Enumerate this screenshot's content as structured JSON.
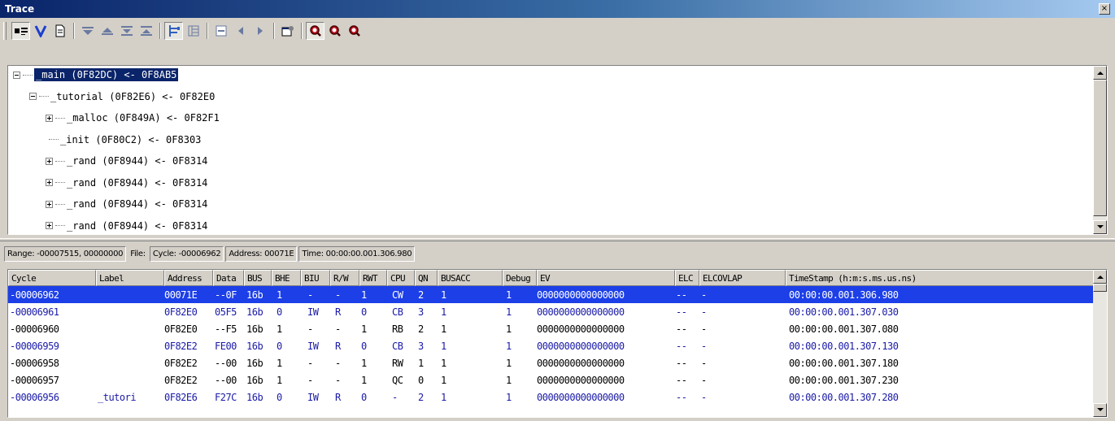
{
  "window": {
    "title": "Trace",
    "close_glyph": "×"
  },
  "toolbar": {
    "buttons": [
      {
        "name": "mixed-view-icon",
        "pressed": true
      },
      {
        "name": "filter-v-icon"
      },
      {
        "name": "document-icon"
      },
      {
        "name": "step-down-icon"
      },
      {
        "name": "step-up-icon"
      },
      {
        "name": "goto-last-icon"
      },
      {
        "name": "goto-first-icon"
      },
      {
        "name": "tree-view-icon",
        "pressed": true
      },
      {
        "name": "tree-list-icon"
      },
      {
        "name": "collapse-icon"
      },
      {
        "name": "arrow-left-icon"
      },
      {
        "name": "arrow-right-icon"
      },
      {
        "name": "properties-icon"
      },
      {
        "name": "search-icon",
        "pressed": true
      },
      {
        "name": "search-prev-icon"
      },
      {
        "name": "search-next-icon"
      }
    ]
  },
  "tree": {
    "rows": [
      {
        "text": "_main (0F82DC) <- 0F8AB5",
        "indent": 0,
        "expander": "minus",
        "selected": true
      },
      {
        "text": "_tutorial (0F82E6) <- 0F82E0",
        "indent": 1,
        "expander": "minus"
      },
      {
        "text": "_malloc (0F849A) <- 0F82F1",
        "indent": 2,
        "expander": "plus"
      },
      {
        "text": "_init (0F80C2) <- 0F8303",
        "indent": 2,
        "expander": "none"
      },
      {
        "text": "_rand (0F8944) <- 0F8314",
        "indent": 2,
        "expander": "plus"
      },
      {
        "text": "_rand (0F8944) <- 0F8314",
        "indent": 2,
        "expander": "plus"
      },
      {
        "text": "_rand (0F8944) <- 0F8314",
        "indent": 2,
        "expander": "plus"
      },
      {
        "text": "_rand (0F8944) <- 0F8314",
        "indent": 2,
        "expander": "plus"
      }
    ]
  },
  "status": {
    "range": "Range: -00007515, 00000000",
    "file_label": "File:",
    "cycle": "Cycle: -00006962",
    "address": "Address: 00071E",
    "time": "Time: 00:00:00.001.306.980"
  },
  "grid": {
    "columns": [
      "Cycle",
      "Label",
      "Address",
      "Data",
      "BUS",
      "BHE",
      "BIU",
      "R/W",
      "RWT",
      "CPU",
      "QN",
      "BUSACC",
      "Debug",
      "EV",
      "ELC",
      "ELCOVLAP",
      "TimeStamp (h:m:s.ms.us.ns)"
    ],
    "rows": [
      {
        "style": "sel",
        "cells": [
          "-00006962",
          "",
          "00071E",
          "--0F",
          "16b",
          "1",
          "-",
          "-",
          "1",
          "CW",
          "2",
          "1",
          "1",
          "0000000000000000",
          "--",
          "-",
          "00:00:00.001.306.980"
        ]
      },
      {
        "style": "blue",
        "cells": [
          "-00006961",
          "",
          "0F82E0",
          "05F5",
          "16b",
          "0",
          "IW",
          "R",
          "0",
          "CB",
          "3",
          "1",
          "1",
          "0000000000000000",
          "--",
          "-",
          "00:00:00.001.307.030"
        ]
      },
      {
        "style": "black",
        "cells": [
          "-00006960",
          "",
          "0F82E0",
          "--F5",
          "16b",
          "1",
          "-",
          "-",
          "1",
          "RB",
          "2",
          "1",
          "1",
          "0000000000000000",
          "--",
          "-",
          "00:00:00.001.307.080"
        ]
      },
      {
        "style": "blue",
        "cells": [
          "-00006959",
          "",
          "0F82E2",
          "FE00",
          "16b",
          "0",
          "IW",
          "R",
          "0",
          "CB",
          "3",
          "1",
          "1",
          "0000000000000000",
          "--",
          "-",
          "00:00:00.001.307.130"
        ]
      },
      {
        "style": "black",
        "cells": [
          "-00006958",
          "",
          "0F82E2",
          "--00",
          "16b",
          "1",
          "-",
          "-",
          "1",
          "RW",
          "1",
          "1",
          "1",
          "0000000000000000",
          "--",
          "-",
          "00:00:00.001.307.180"
        ]
      },
      {
        "style": "black",
        "cells": [
          "-00006957",
          "",
          "0F82E2",
          "--00",
          "16b",
          "1",
          "-",
          "-",
          "1",
          "QC",
          "0",
          "1",
          "1",
          "0000000000000000",
          "--",
          "-",
          "00:00:00.001.307.230"
        ]
      },
      {
        "style": "blue",
        "cells": [
          "-00006956",
          "_tutori",
          "0F82E6",
          "F27C",
          "16b",
          "0",
          "IW",
          "R",
          "0",
          "-",
          "2",
          "1",
          "1",
          "0000000000000000",
          "--",
          "-",
          "00:00:00.001.307.280"
        ]
      }
    ]
  },
  "colors": {
    "selection": "#1c3fe8",
    "title_start": "#0a246a",
    "text_blue": "#1a1aa8"
  }
}
